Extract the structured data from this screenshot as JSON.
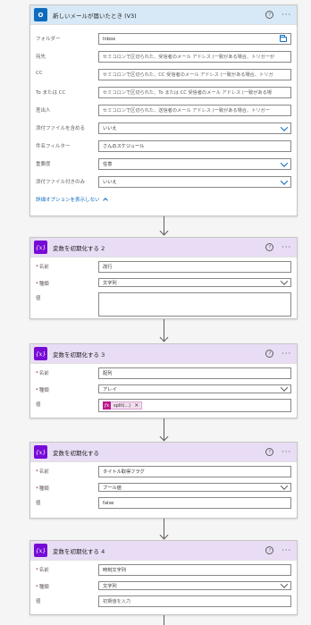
{
  "trigger": {
    "title": "新しいメールが届いたとき (V3)",
    "icon": "outlook-icon",
    "fields": [
      {
        "label": "フォルダー",
        "value": "Inbox",
        "kind": "folder"
      },
      {
        "label": "宛先",
        "value": "セミコロンで区切られた、受信者のメール アドレス (一致がある場合、トリガーが",
        "kind": "text"
      },
      {
        "label": "CC",
        "value": "セミコロンで区切られた、CC 受信者のメール アドレス (一致がある場合、トリガ",
        "kind": "text"
      },
      {
        "label": "To または CC",
        "value": "セミコロンで区切られた、To または CC 受信者のメール アドレス (一致がある場",
        "kind": "text"
      },
      {
        "label": "差出人",
        "value": "セミコロンで区切られた、送信者のメール アドレス (一致がある場合、トリガー",
        "kind": "text"
      },
      {
        "label": "添付ファイルを含める",
        "value": "いいえ",
        "kind": "dropdown"
      },
      {
        "label": "件名フィルター",
        "value": "さんのスケジュール",
        "kind": "text"
      },
      {
        "label": "重要度",
        "value": "任意",
        "kind": "dropdown"
      },
      {
        "label": "添付ファイル付きのみ",
        "value": "いいえ",
        "kind": "dropdown"
      }
    ],
    "advanced_link": "詳細オプションを表示しない"
  },
  "var_cards": [
    {
      "title": "変数を初期化する 2",
      "name_label": "名前",
      "type_label": "種類",
      "value_label": "値",
      "name_value": "改行",
      "type_value": "文字列",
      "value": ""
    },
    {
      "title": "変数を初期化する 3",
      "name_label": "名前",
      "type_label": "種類",
      "value_label": "値",
      "name_value": "配列",
      "type_value": "アレイ",
      "token": "split(...)"
    },
    {
      "title": "変数を初期化する",
      "name_label": "名前",
      "type_label": "種類",
      "value_label": "値",
      "name_value": "タイトル取得フラグ",
      "type_value": "ブール値",
      "value": "false"
    },
    {
      "title": "変数を初期化する 4",
      "name_label": "名前",
      "type_label": "種類",
      "value_label": "値",
      "name_value": "時刻文字列",
      "type_value": "文字列",
      "value_placeholder": "初期値を入力"
    }
  ],
  "common": {
    "help_glyph": "?",
    "more_glyph": "···",
    "var_icon_glyph": "{x}",
    "outlook_icon_glyph": "O",
    "fx_glyph": "fx",
    "token_close_glyph": "×",
    "required_mark": "*"
  },
  "colors": {
    "outlook_header": "#d7e9f7",
    "outlook_brand": "#0f6cbd",
    "variable_header": "#e9ddf5",
    "variable_brand": "#770bd6",
    "expression_token": "#bd1a8d"
  }
}
